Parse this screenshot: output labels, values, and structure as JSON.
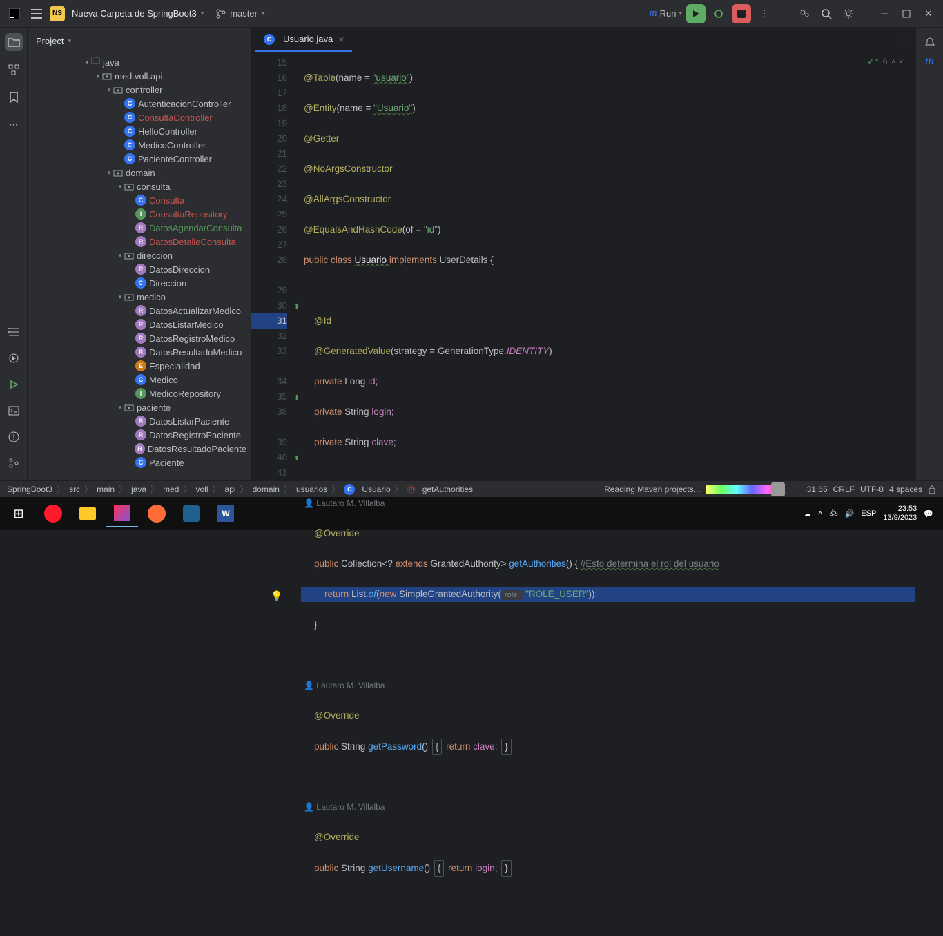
{
  "topbar": {
    "project": "Nueva Carpeta de SpringBoot3",
    "branch": "master",
    "run_label": "Run"
  },
  "project_panel": {
    "title": "Project"
  },
  "tree": [
    {
      "d": 5,
      "tw": "▾",
      "icon": "folder",
      "label": "java"
    },
    {
      "d": 6,
      "tw": "▾",
      "icon": "pkg",
      "label": "med.voll.api"
    },
    {
      "d": 7,
      "tw": "▾",
      "icon": "pkg",
      "label": "controller"
    },
    {
      "d": 8,
      "tw": "",
      "icon": "c",
      "label": "AutenticacionController"
    },
    {
      "d": 8,
      "tw": "",
      "icon": "c",
      "label": "ConsultaController",
      "cls": "red"
    },
    {
      "d": 8,
      "tw": "",
      "icon": "c",
      "label": "HelloController"
    },
    {
      "d": 8,
      "tw": "",
      "icon": "c",
      "label": "MedicoController"
    },
    {
      "d": 8,
      "tw": "",
      "icon": "c",
      "label": "PacienteController"
    },
    {
      "d": 7,
      "tw": "▾",
      "icon": "pkg",
      "label": "domain"
    },
    {
      "d": 8,
      "tw": "▾",
      "icon": "pkg",
      "label": "consulta"
    },
    {
      "d": 9,
      "tw": "",
      "icon": "c",
      "label": "Consulta",
      "cls": "red"
    },
    {
      "d": 9,
      "tw": "",
      "icon": "i",
      "label": "ConsultaRepository",
      "cls": "red"
    },
    {
      "d": 9,
      "tw": "",
      "icon": "r",
      "label": "DatosAgendarConsulta",
      "cls": "green"
    },
    {
      "d": 9,
      "tw": "",
      "icon": "r",
      "label": "DatosDetalleConsulta",
      "cls": "red"
    },
    {
      "d": 8,
      "tw": "▾",
      "icon": "pkg",
      "label": "direccion"
    },
    {
      "d": 9,
      "tw": "",
      "icon": "r",
      "label": "DatosDireccion"
    },
    {
      "d": 9,
      "tw": "",
      "icon": "c",
      "label": "Direccion"
    },
    {
      "d": 8,
      "tw": "▾",
      "icon": "pkg",
      "label": "medico"
    },
    {
      "d": 9,
      "tw": "",
      "icon": "r",
      "label": "DatosActualizarMedico"
    },
    {
      "d": 9,
      "tw": "",
      "icon": "r",
      "label": "DatosListarMedico"
    },
    {
      "d": 9,
      "tw": "",
      "icon": "r",
      "label": "DatosRegistroMedico"
    },
    {
      "d": 9,
      "tw": "",
      "icon": "r",
      "label": "DatosResultadoMedico"
    },
    {
      "d": 9,
      "tw": "",
      "icon": "e",
      "label": "Especialidad"
    },
    {
      "d": 9,
      "tw": "",
      "icon": "c",
      "label": "Medico"
    },
    {
      "d": 9,
      "tw": "",
      "icon": "i",
      "label": "MedicoRepository"
    },
    {
      "d": 8,
      "tw": "▾",
      "icon": "pkg",
      "label": "paciente"
    },
    {
      "d": 9,
      "tw": "",
      "icon": "r",
      "label": "DatosListarPaciente"
    },
    {
      "d": 9,
      "tw": "",
      "icon": "r",
      "label": "DatosRegistroPaciente"
    },
    {
      "d": 9,
      "tw": "",
      "icon": "r",
      "label": "DatosResultadoPaciente"
    },
    {
      "d": 9,
      "tw": "",
      "icon": "c",
      "label": "Paciente"
    }
  ],
  "tab": {
    "title": "Usuario.java"
  },
  "inspection": {
    "count": "6"
  },
  "authors": {
    "a1": "Lautaro M. Villalba",
    "a2": "Lautaro M. Villalba",
    "a3": "Lautaro M. Villalba"
  },
  "code": {
    "l15": {
      "a": "@Table",
      "b": "(name = ",
      "c": "\"usuario\"",
      "d": ")"
    },
    "l16": {
      "a": "@Entity",
      "b": "(name = ",
      "c": "\"Usuario\"",
      "d": ")"
    },
    "l17": "@Getter",
    "l18": "@NoArgsConstructor",
    "l19": "@AllArgsConstructor",
    "l20": {
      "a": "@EqualsAndHashCode",
      "b": "(of = ",
      "c": "\"id\"",
      "d": ")"
    },
    "l21": {
      "a": "public class ",
      "b": "Usuario ",
      "c": "implements ",
      "d": "UserDetails {"
    },
    "l23": "    @Id",
    "l24": {
      "a": "    @GeneratedValue",
      "b": "(strategy = GenerationType.",
      "c": "IDENTITY",
      "d": ")"
    },
    "l25": {
      "a": "    private ",
      "b": "Long ",
      "c": "id",
      ";": ";"
    },
    "l26": {
      "a": "    private ",
      "b": "String ",
      "c": "login",
      ";": ";"
    },
    "l27": {
      "a": "    private ",
      "b": "String ",
      "c": "clave",
      ";": ";"
    },
    "l29": "    @Override",
    "l30": {
      "a": "    public ",
      "b": "Collection",
      "c": "<? ",
      "d": "extends ",
      "e": "GrantedAuthority> ",
      "f": "getAuthorities",
      "g": "() { ",
      "h": "//Esto determina el rol del usuario"
    },
    "l31": {
      "a": "        return ",
      "b": "List.",
      "c": "of",
      "d": "(",
      "e": "new ",
      "f": "SimpleGrantedAuthority(",
      "hint": "role:",
      "g": " \"ROLE_USER\"",
      "h": "));"
    },
    "l32": "    }",
    "l34": "    @Override",
    "l35": {
      "a": "    public ",
      "b": "String ",
      "c": "getPassword",
      "d": "() ",
      "e": "return ",
      "f": "clave",
      "g": ";"
    },
    "l39": "    @Override",
    "l40": {
      "a": "    public ",
      "b": "String ",
      "c": "getUsername",
      "d": "() ",
      "e": "return ",
      "f": "login",
      "g": ";"
    }
  },
  "gutter": [
    "15",
    "16",
    "17",
    "18",
    "19",
    "20",
    "21",
    "22",
    "23",
    "24",
    "25",
    "26",
    "27",
    "28",
    "",
    "29",
    "30",
    "31",
    "32",
    "33",
    "",
    "34",
    "35",
    "38",
    "",
    "39",
    "40",
    "43"
  ],
  "breadcrumbs": [
    "SpringBoot3",
    "src",
    "main",
    "java",
    "med",
    "voll",
    "api",
    "domain",
    "usuarios",
    "Usuario",
    "getAuthorities"
  ],
  "status": {
    "task": "Reading Maven projects...",
    "pos": "31:65",
    "eol": "CRLF",
    "enc": "UTF-8",
    "indent": "4 spaces"
  },
  "taskbar": {
    "lang": "ESP",
    "time": "23:53",
    "date": "13/9/2023"
  }
}
